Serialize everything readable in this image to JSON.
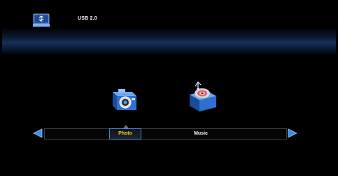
{
  "header": {
    "device_label": "USB 2.0",
    "device_icon": "usb-drive-icon"
  },
  "media_types": [
    {
      "label": "Photo",
      "icon": "camera-icon",
      "selected": true
    },
    {
      "label": "Music",
      "icon": "music-disc-icon",
      "selected": false
    }
  ],
  "navigation": {
    "left_icon": "arrow-left-icon",
    "right_icon": "arrow-right-icon"
  },
  "colors": {
    "background": "#000000",
    "selected_text": "#f3d21d",
    "text": "#ffffff",
    "accent_blue": "#2f7fe0"
  }
}
